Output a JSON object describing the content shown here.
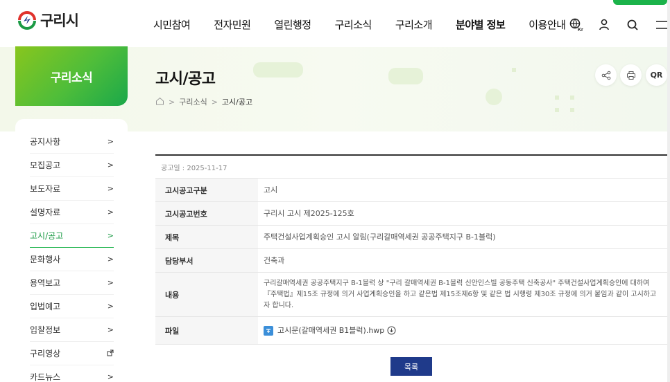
{
  "logo": {
    "text": "구리시"
  },
  "gnb": [
    "시민참여",
    "전자민원",
    "열린행정",
    "구리소식",
    "구리소개",
    "분야별 정보",
    "이용안내"
  ],
  "utils": [
    "language-icon",
    "user-icon",
    "search-icon",
    "menu-icon"
  ],
  "lang_badge": "Kr",
  "side_title": "구리소식",
  "page_title": "고시/공고",
  "breadcrumb": {
    "level1": "구리소식",
    "current": "고시/공고"
  },
  "actions": {
    "qr_label": "QR"
  },
  "sidebar": {
    "items": [
      {
        "label": "공지사항",
        "icon": "chevron-right"
      },
      {
        "label": "모집공고",
        "icon": "chevron-right"
      },
      {
        "label": "보도자료",
        "icon": "chevron-right"
      },
      {
        "label": "설명자료",
        "icon": "chevron-right"
      },
      {
        "label": "고시/공고",
        "icon": "chevron-right",
        "active": true
      },
      {
        "label": "문화행사",
        "icon": "chevron-right"
      },
      {
        "label": "용역보고",
        "icon": "chevron-right"
      },
      {
        "label": "입법예고",
        "icon": "chevron-right"
      },
      {
        "label": "입찰정보",
        "icon": "chevron-right"
      },
      {
        "label": "구리영상",
        "icon": "external-link"
      },
      {
        "label": "카드뉴스",
        "icon": "chevron-right"
      }
    ]
  },
  "notice": {
    "date": "공고일 : 2025-11-17",
    "rows": [
      {
        "label": "고시공고구분",
        "value": "고시"
      },
      {
        "label": "고시공고번호",
        "value": "구리시 고시 제2025-125호"
      },
      {
        "label": "제목",
        "value": "주택건설사업계획승인 고시 알림(구리갈매역세권 공공주택지구 B-1블럭)"
      },
      {
        "label": "담당부서",
        "value": "건축과"
      },
      {
        "label": "내용",
        "value": "구리갈매역세권 공공주택지구 B-1블럭 상 \"구리 갈매역세권 B-1블럭 신안인스빌 공동주택 신축공사\" 주택건설사업계획승인에 대하여『주택법』제15조 규정에 의거 사업계획승인을 하고 같은법 제15조제6항 및 같은 법 시행령 제30조 규정에 의거 붙임과 같이 고시하고자 합니다."
      },
      {
        "label": "파일",
        "value": "고시문(갈매역세권 B1블럭).hwp"
      }
    ]
  },
  "list_button": "목록",
  "colors": {
    "accent_green": "#1bb34a",
    "button_navy": "#1f3a8a"
  }
}
